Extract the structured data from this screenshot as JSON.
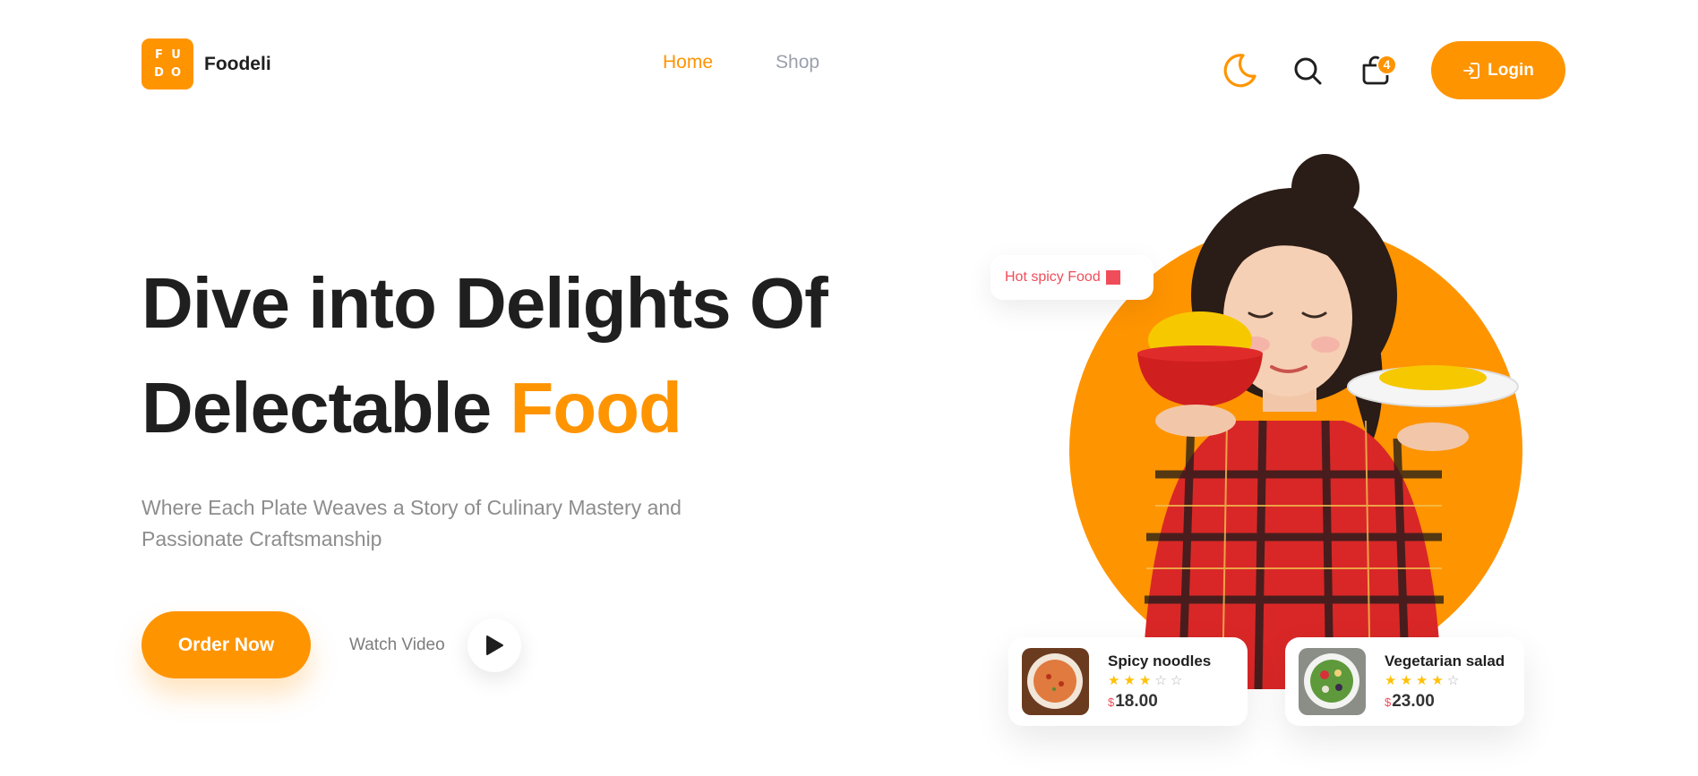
{
  "brand": {
    "logo_letters": [
      "F",
      "U",
      "D",
      "O"
    ],
    "name": "Foodeli"
  },
  "nav": {
    "items": [
      {
        "label": "Home",
        "active": true
      },
      {
        "label": "Shop",
        "active": false
      }
    ]
  },
  "header_actions": {
    "theme_icon": "moon-icon",
    "search_icon": "search-icon",
    "cart_icon": "shopping-bag-icon",
    "cart_count": "4",
    "login_label": "Login",
    "login_icon": "login-icon"
  },
  "hero": {
    "title_line1": "Dive into Delights Of",
    "title_line2_plain": "Delectable ",
    "title_line2_accent": "Food",
    "subtitle": "Where Each Plate Weaves a Story of Culinary Mastery and Passionate Craftsmanship",
    "order_label": "Order Now",
    "watch_label": "Watch Video",
    "play_icon": "play-icon"
  },
  "illustration": {
    "tag_label": "Hot spicy Food",
    "cards": [
      {
        "name": "Spicy noodles",
        "rating": 3,
        "max_rating": 5,
        "currency": "$",
        "price": "18.00"
      },
      {
        "name": "Vegetarian salad",
        "rating": 4,
        "max_rating": 5,
        "currency": "$",
        "price": "23.00"
      }
    ]
  },
  "colors": {
    "accent": "#ff9401",
    "text_dark": "#1f1f1f",
    "text_muted": "#8d8d8d",
    "nav_inactive": "#9aa0ac",
    "hot_tag": "#ef4d59",
    "star": "#ffc107"
  }
}
